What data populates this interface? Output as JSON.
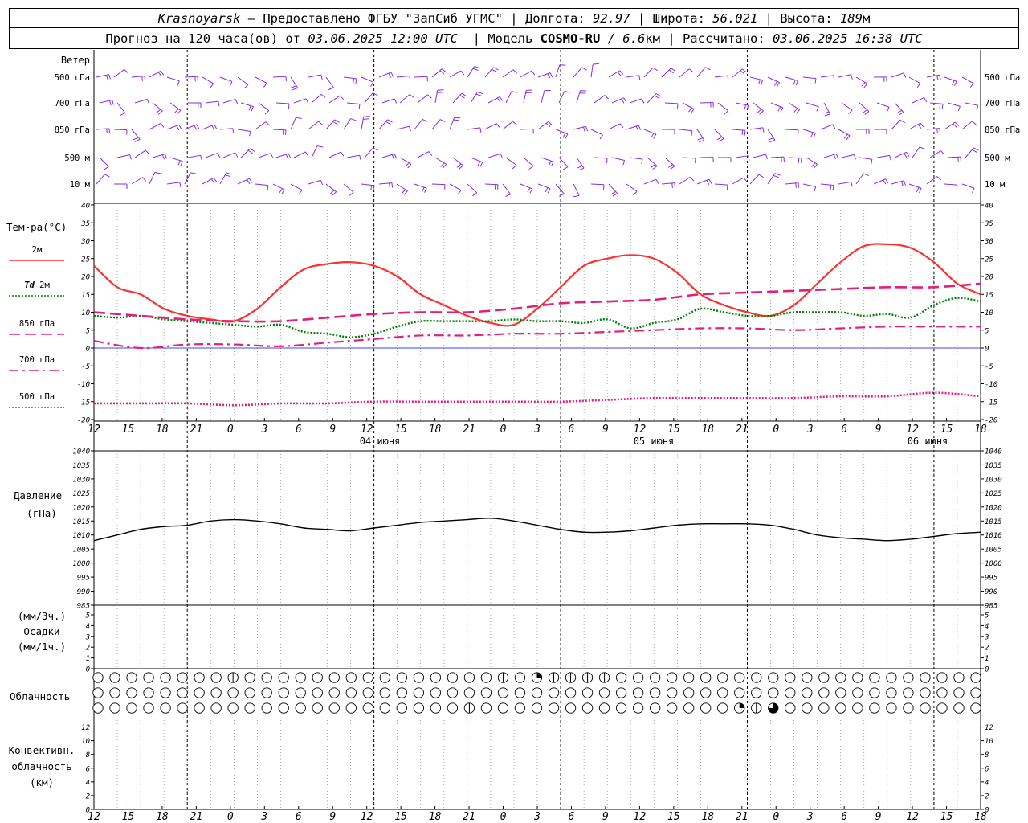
{
  "header": {
    "city": "Krasnoyarsk",
    "provider": " – Предоставлено ФГБУ \"ЗапСиб УГМС\" | Долгота: ",
    "lon": "92.97",
    "lat_label": " | Широта: ",
    "lat": "56.021",
    "alt_label": " | Высота: ",
    "alt": "189",
    "alt_unit": "м",
    "fc_label": "Прогноз на 120 часа(ов) от ",
    "fc_start": "03.06.2025 12:00 UTC",
    "model_label": "  | Модель ",
    "model": "COSMO-RU",
    "res": " / 6.6",
    "res_unit": "км",
    "calc_label": " | Рассчитано: ",
    "calc_time": "03.06.2025 16:38 UTC"
  },
  "colors": {
    "wind": "#8a2be2",
    "t2m": "#ff3030",
    "td2m": "#008000",
    "t850": "#e0207a",
    "t700": "#e0207a",
    "t500": "#e0207a",
    "pressure": "#000000",
    "zero_line": "#0000ff",
    "grid": "#888888"
  },
  "wind_panel": {
    "title": "Ветер",
    "levels": [
      "500 гПа",
      "700 гПа",
      "850 гПа",
      "500 м",
      "10 м"
    ]
  },
  "temp_panel": {
    "title": "Тем-ра(°C)",
    "legend": [
      {
        "label": "2м",
        "italic": "",
        "style": "solid",
        "color": "#ff3030"
      },
      {
        "label": " 2м",
        "italic": "Td",
        "style": "dotted",
        "color": "#008000"
      },
      {
        "label": "850 гПа",
        "italic": "",
        "style": "long-dash",
        "color": "#e0207a"
      },
      {
        "label": "700 гПа",
        "italic": "",
        "style": "dash-dot",
        "color": "#e0207a"
      },
      {
        "label": "500 гПа",
        "italic": "",
        "style": "dotted",
        "color": "#e0207a"
      }
    ]
  },
  "pressure_panel": {
    "title": "Давление",
    "unit": "(гПа)"
  },
  "precip_panel": {
    "label1": "(мм/3ч.)",
    "label2": "Осадки",
    "label3": "(мм/1ч.)"
  },
  "cloud_panel": {
    "label": "Облачность",
    "rows": 3,
    "symbols": 53,
    "special": [
      {
        "row": 0,
        "index": 8,
        "fill": "half"
      },
      {
        "row": 0,
        "index": 24,
        "fill": "half"
      },
      {
        "row": 0,
        "index": 25,
        "fill": "half"
      },
      {
        "row": 0,
        "index": 26,
        "fill": "quarter"
      },
      {
        "row": 0,
        "index": 27,
        "fill": "half"
      },
      {
        "row": 0,
        "index": 28,
        "fill": "half"
      },
      {
        "row": 0,
        "index": 29,
        "fill": "half"
      },
      {
        "row": 0,
        "index": 30,
        "fill": "half"
      },
      {
        "row": 2,
        "index": 22,
        "fill": "half"
      },
      {
        "row": 2,
        "index": 38,
        "fill": "quarter"
      },
      {
        "row": 2,
        "index": 39,
        "fill": "half"
      },
      {
        "row": 2,
        "index": 40,
        "fill": "three-quarter"
      }
    ]
  },
  "conv_panel": {
    "label1": "Конвективн.",
    "label2": "облачность",
    "label3": "(км)"
  },
  "x_axis": {
    "hour_labels": [
      "12",
      "15",
      "18",
      "21",
      "0",
      "3",
      "6",
      "9",
      "12",
      "15",
      "18",
      "21",
      "0",
      "3",
      "6",
      "9",
      "12",
      "15",
      "18",
      "21",
      "0",
      "3",
      "6",
      "9",
      "12",
      "15",
      "18"
    ],
    "day_labels": [
      "04 июня",
      "05 июня",
      "06 июня"
    ]
  },
  "chart_data": [
    {
      "type": "line",
      "title": "Тем-ра(°C)",
      "x_unit": "hours from 03.06.2025 12:00 UTC",
      "ylim": [
        -20,
        40
      ],
      "y_ticks": [
        40,
        35,
        30,
        25,
        20,
        15,
        10,
        5,
        0,
        -5,
        -10,
        -15,
        -20
      ],
      "series": [
        {
          "name": "2м",
          "x": [
            0,
            3,
            6,
            9,
            12,
            15,
            18,
            21,
            24,
            27,
            30,
            33,
            36,
            39,
            42,
            45,
            48,
            51,
            54,
            57,
            60,
            63,
            66,
            69,
            72,
            75,
            78,
            81,
            84,
            87,
            90,
            93,
            96,
            99,
            102,
            105,
            108,
            111,
            114
          ],
          "values": [
            23,
            17,
            15,
            11,
            9,
            8,
            7.5,
            11,
            17,
            22,
            23.5,
            24,
            23,
            20,
            15,
            12,
            9,
            7,
            6.5,
            11,
            17,
            23,
            25,
            26,
            25,
            21,
            15,
            12,
            10,
            9,
            12,
            18,
            24,
            28.5,
            29,
            28,
            24,
            18,
            15
          ]
        },
        {
          "name": "Td 2м",
          "x": [
            0,
            3,
            6,
            9,
            12,
            15,
            18,
            21,
            24,
            27,
            30,
            33,
            36,
            39,
            42,
            45,
            48,
            51,
            54,
            57,
            60,
            63,
            66,
            69,
            72,
            75,
            78,
            81,
            84,
            87,
            90,
            93,
            96,
            99,
            102,
            105,
            108,
            111,
            114
          ],
          "values": [
            9,
            8.5,
            9,
            8,
            7.5,
            7,
            6.5,
            6,
            6.5,
            4.5,
            4,
            3,
            4,
            6,
            7.5,
            7.5,
            7.5,
            7.5,
            8,
            7.5,
            7.5,
            7,
            8,
            5.5,
            7,
            8,
            11,
            10,
            9,
            9,
            10,
            10,
            10,
            9,
            9.5,
            8.5,
            12,
            14,
            13
          ]
        },
        {
          "name": "850 гПа",
          "x": [
            0,
            6,
            12,
            18,
            24,
            30,
            36,
            42,
            48,
            54,
            60,
            66,
            72,
            78,
            84,
            90,
            96,
            102,
            108,
            114
          ],
          "values": [
            10,
            9,
            8,
            7.5,
            7.5,
            8.5,
            9.5,
            10,
            10,
            11,
            12.5,
            13,
            13.5,
            15,
            15.5,
            16,
            16.5,
            17,
            17,
            18
          ]
        },
        {
          "name": "700 гПа",
          "x": [
            0,
            6,
            12,
            18,
            24,
            30,
            36,
            42,
            48,
            54,
            60,
            66,
            72,
            78,
            84,
            90,
            96,
            102,
            108,
            114
          ],
          "values": [
            2,
            0,
            1,
            1,
            0.5,
            1.5,
            2.5,
            3.5,
            3.5,
            4,
            4,
            4.5,
            5,
            5.5,
            5.5,
            5,
            5.5,
            6,
            6,
            6
          ]
        },
        {
          "name": "500 гПа",
          "x": [
            0,
            6,
            12,
            18,
            24,
            30,
            36,
            42,
            48,
            54,
            60,
            66,
            72,
            78,
            84,
            90,
            96,
            102,
            108,
            114
          ],
          "values": [
            -15.5,
            -15.5,
            -15.5,
            -16,
            -15.5,
            -15.5,
            -15,
            -15,
            -15,
            -15,
            -15,
            -14.5,
            -14,
            -14,
            -14,
            -14,
            -13.5,
            -13.5,
            -12.5,
            -13.5
          ]
        }
      ]
    },
    {
      "type": "line",
      "title": "Давление",
      "x_unit": "hours from 03.06.2025 12:00 UTC",
      "ylim": [
        985,
        1040
      ],
      "y_ticks": [
        1040,
        1035,
        1030,
        1025,
        1020,
        1015,
        1010,
        1005,
        1000,
        995,
        990,
        985
      ],
      "series": [
        {
          "name": "",
          "x": [
            0,
            3,
            6,
            9,
            12,
            15,
            18,
            21,
            24,
            27,
            30,
            33,
            36,
            39,
            42,
            45,
            48,
            51,
            54,
            57,
            60,
            63,
            66,
            69,
            72,
            75,
            78,
            81,
            84,
            87,
            90,
            93,
            96,
            99,
            102,
            105,
            108,
            111,
            114
          ],
          "values": [
            1008,
            1010,
            1012,
            1013,
            1013.5,
            1015,
            1015.5,
            1015,
            1014,
            1012.5,
            1012,
            1011.5,
            1012.5,
            1013.5,
            1014.5,
            1015,
            1015.5,
            1016,
            1015,
            1013.5,
            1012,
            1011,
            1011,
            1011.5,
            1012.5,
            1013.5,
            1014,
            1014,
            1014,
            1013.5,
            1012,
            1010,
            1009,
            1008.5,
            1008,
            1008.5,
            1009.5,
            1010.5,
            1011
          ]
        }
      ]
    },
    {
      "type": "line",
      "title": "Осадки",
      "ylim": [
        0,
        5
      ],
      "y_ticks": [
        5,
        4,
        3,
        2,
        1,
        0
      ],
      "series": []
    },
    {
      "type": "line",
      "title": "Конвективн. облачность",
      "ylim": [
        0,
        13
      ],
      "y_ticks": [
        12,
        10,
        8,
        6,
        4,
        2,
        0
      ],
      "series": []
    }
  ]
}
